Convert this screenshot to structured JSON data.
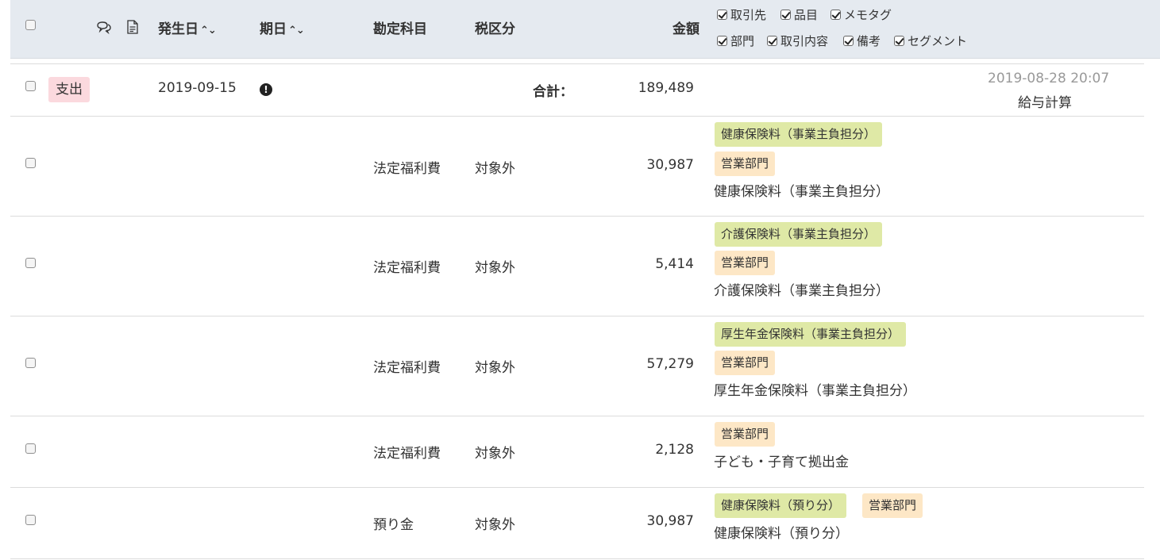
{
  "header": {
    "occurrence_date": "発生日",
    "due_date": "期日",
    "account": "勘定科目",
    "tax": "税区分",
    "amount": "金額",
    "sort_arrows": "⌃⌄",
    "column_options": [
      {
        "label": "取引先",
        "checked": true
      },
      {
        "label": "品目",
        "checked": true
      },
      {
        "label": "メモタグ",
        "checked": true
      },
      {
        "label": "部門",
        "checked": true
      },
      {
        "label": "取引内容",
        "checked": true
      },
      {
        "label": "備考",
        "checked": true
      },
      {
        "label": "セグメント",
        "checked": true
      }
    ]
  },
  "icons": {
    "comment": "comment-icon",
    "document": "document-icon",
    "alert": "exclamation-circle-icon"
  },
  "summary": {
    "type_badge": "支出",
    "date": "2019-09-15",
    "alert_glyph": "!",
    "total_label": "合計：",
    "total_amount": "189,489",
    "timestamp": "2019-08-28 20:07",
    "description": "給与計算"
  },
  "lines": [
    {
      "account": "法定福利費",
      "tax": "対象外",
      "amount": "30,987",
      "item_tag": "健康保険料（事業主負担分）",
      "dept_tag": "営業部門",
      "description": "健康保険料（事業主負担分）"
    },
    {
      "account": "法定福利費",
      "tax": "対象外",
      "amount": "5,414",
      "item_tag": "介護保険料（事業主負担分）",
      "dept_tag": "営業部門",
      "description": "介護保険料（事業主負担分）"
    },
    {
      "account": "法定福利費",
      "tax": "対象外",
      "amount": "57,279",
      "item_tag": "厚生年金保険料（事業主負担分）",
      "dept_tag": "営業部門",
      "description": "厚生年金保険料（事業主負担分）"
    },
    {
      "account": "法定福利費",
      "tax": "対象外",
      "amount": "2,128",
      "dept_tag": "営業部門",
      "description": "子ども・子育て拠出金"
    },
    {
      "account": "預り金",
      "tax": "対象外",
      "amount": "30,987",
      "item_tag": "健康保険料（預り分）",
      "dept_tag": "営業部門",
      "description": "健康保険料（預り分）"
    }
  ],
  "colors": {
    "header_bg": "#e5eaf0",
    "item_tag_bg": "#dfe9a6",
    "dept_tag_bg": "#fde7c6",
    "expense_badge_bg": "#fbd9de"
  }
}
